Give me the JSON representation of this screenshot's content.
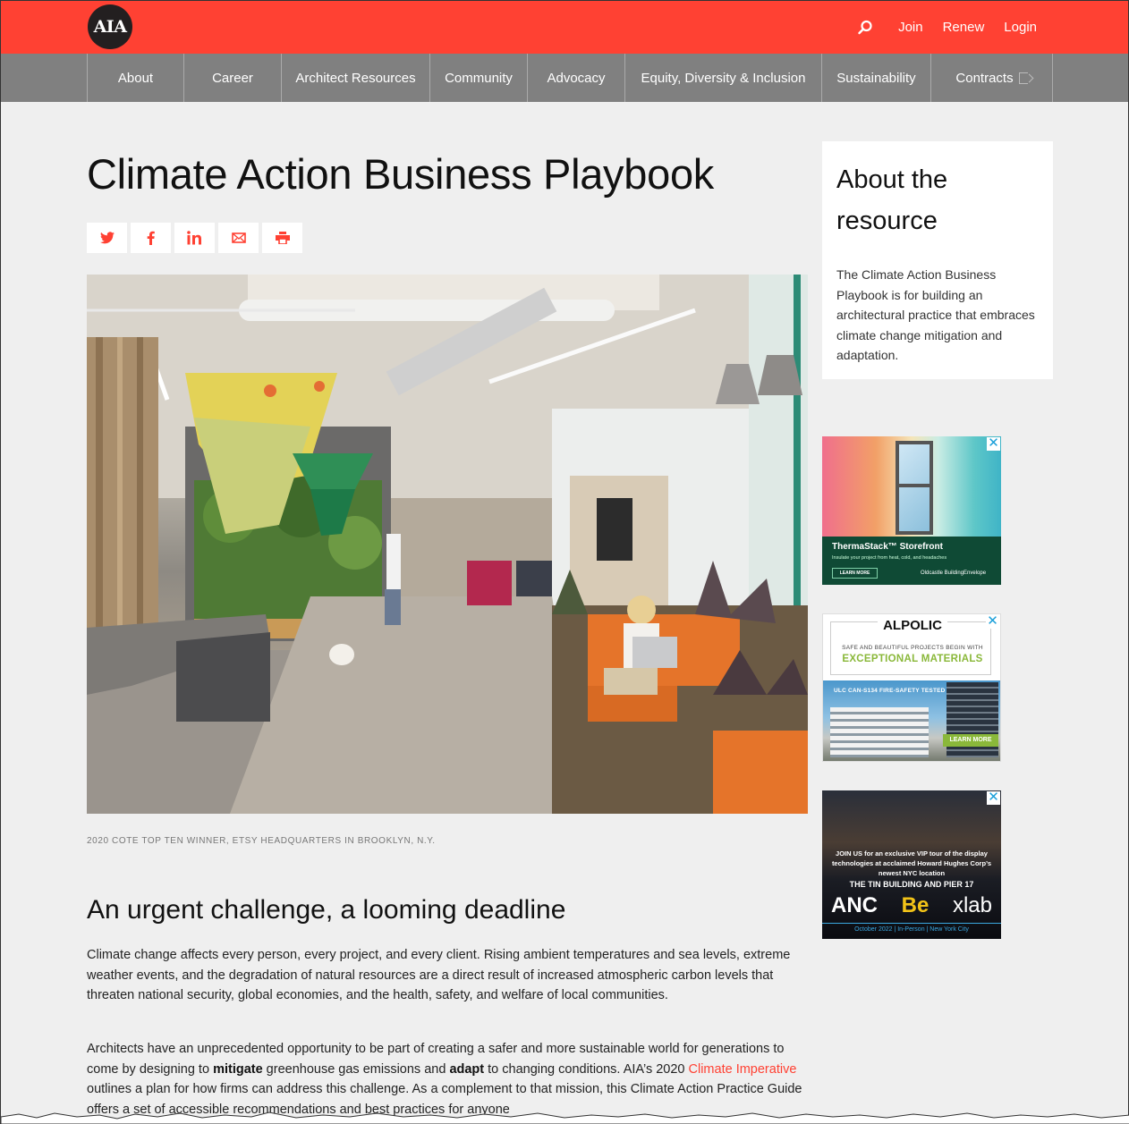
{
  "header": {
    "logo_text": "AIA",
    "utility_links": [
      "Join",
      "Renew",
      "Login"
    ],
    "search_icon": "search-icon",
    "brand_color": "#ff4133"
  },
  "nav": {
    "items": [
      {
        "label": "About"
      },
      {
        "label": "Career"
      },
      {
        "label": "Architect Resources"
      },
      {
        "label": "Community"
      },
      {
        "label": "Advocacy"
      },
      {
        "label": "Equity, Diversity & Inclusion"
      },
      {
        "label": "Sustainability"
      },
      {
        "label": "Contracts",
        "icon": "external-link-icon"
      }
    ]
  },
  "main": {
    "title": "Climate Action Business Playbook",
    "share_buttons": [
      {
        "name": "twitter",
        "icon": "twitter-icon"
      },
      {
        "name": "facebook",
        "icon": "facebook-icon"
      },
      {
        "name": "linkedin",
        "icon": "linkedin-icon"
      },
      {
        "name": "email",
        "icon": "email-icon"
      },
      {
        "name": "print",
        "icon": "print-icon"
      }
    ],
    "hero_alt": "Etsy headquarters office interior with hanging sculptures, green wall, and orange booth seating",
    "caption": "2020 COTE TOP TEN WINNER, ETSY HEADQUARTERS IN BROOKLYN, N.Y.",
    "section_heading": "An urgent challenge, a looming deadline",
    "paragraph1": "Climate change affects every person, every project, and every client. Rising ambient temperatures and sea levels, extreme weather events, and the degradation of natural resources are a direct result of increased atmospheric carbon levels that threaten national security, global economies, and the health, safety, and welfare of local communities.",
    "paragraph2": {
      "part1": "Architects have an unprecedented opportunity to be part of creating a safer and more sustainable world for generations to come by designing to ",
      "bold1": "mitigate",
      "part2": " greenhouse gas emissions and ",
      "bold2": "adapt",
      "part3": " to changing conditions. AIA’s 2020 ",
      "link": "Climate Imperative",
      "part4": " outlines a plan for how firms can address this challenge. As a complement to that mission, this Climate Action Practice Guide offers a set of accessible recommendations and best practices for anyone"
    }
  },
  "sidebar": {
    "about_heading": "About the resource",
    "about_text": "The Climate Action Business Playbook is for building an architectural practice that embraces climate change mitigation and adaptation.",
    "ads": [
      {
        "title": "ThermaStack™ Storefront",
        "subtitle": "Insulate your project from heat, cold, and headaches",
        "cta": "LEARN MORE",
        "brand": "Oldcastle BuildingEnvelope"
      },
      {
        "logo": "ALPOLIC",
        "line1": "SAFE AND BEAUTIFUL PROJECTS BEGIN WITH",
        "line2": "EXCEPTIONAL MATERIALS",
        "tag": "ULC CAN-S134 FIRE-SAFETY TESTED",
        "cta": "LEARN MORE"
      },
      {
        "line1": "JOIN US for an exclusive VIP tour of the display technologies at acclaimed Howard Hughes Corp’s newest NYC location",
        "line2": "THE TIN BUILDING AND PIER 17",
        "logos": [
          "ANC",
          "Be",
          "xlab"
        ],
        "footer": "October 2022 | In-Person | New York City"
      }
    ],
    "close_glyph": "✕"
  }
}
